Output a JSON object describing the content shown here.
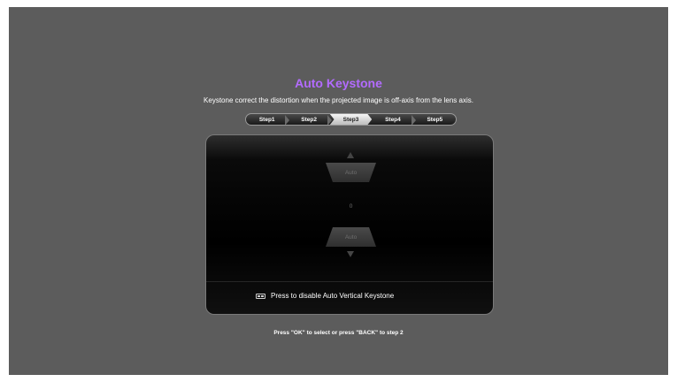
{
  "title": "Auto Keystone",
  "subtitle": "Keystone correct the distortion when the projected image is off-axis from the lens axis.",
  "steps": [
    {
      "label": "Step1",
      "active": false
    },
    {
      "label": "Step2",
      "active": false
    },
    {
      "label": "Step3",
      "active": true
    },
    {
      "label": "Step4",
      "active": false
    },
    {
      "label": "Step5",
      "active": false
    }
  ],
  "keystone": {
    "top_label": "Auto",
    "value": "0",
    "bottom_label": "Auto",
    "up_icon": "triangle-up-icon",
    "down_icon": "triangle-down-icon"
  },
  "hint": {
    "icon": "auto-keystone-key-icon",
    "text": "Press to disable Auto Vertical Keystone"
  },
  "footer": "Press \"OK\" to select or press \"BACK\" to step 2",
  "colors": {
    "title": "#b36bff",
    "background": "#5c5c5c",
    "panel": "#000000"
  }
}
